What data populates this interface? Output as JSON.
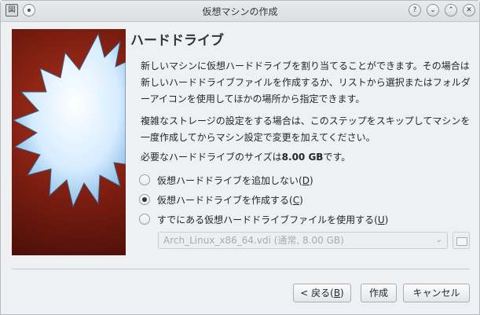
{
  "window": {
    "title": "仮想マシンの作成",
    "app_icon_glyph": "図",
    "controls": {
      "help": "?",
      "minimize": "⌄",
      "maximize": "⌃",
      "close": "✕"
    }
  },
  "page": {
    "heading": "ハードドライブ",
    "paragraph1": "新しいマシンに仮想ハードドライブを割り当てることができます。その場合は新しいハードドライブファイルを作成するか、リストから選択またはフォルダーアイコンを使用してほかの場所から指定できます。",
    "paragraph2": "複雑なストレージの設定をする場合は、このステップをスキップしてマシンを一度作成してからマシン設定で変更を加えてください。",
    "paragraph3_prefix": "必要なハードドライブのサイズは",
    "paragraph3_size": "8.00 GB",
    "paragraph3_suffix": "です。"
  },
  "options": [
    {
      "label": "仮想ハードドライブを追加しない(",
      "mnemonic": "D",
      "close": ")",
      "checked": false
    },
    {
      "label": "仮想ハードドライブを作成する(",
      "mnemonic": "C",
      "close": ")",
      "checked": true
    },
    {
      "label": "すでにある仮想ハードドライブファイルを使用する(",
      "mnemonic": "U",
      "close": ")",
      "checked": false
    }
  ],
  "disk_select": {
    "value": "Arch_Linux_x86_64.vdi (通常, 8.00 GB)"
  },
  "buttons": {
    "back_prefix": "< 戻る(",
    "back_mnemonic": "B",
    "back_suffix": ")",
    "create": "作成",
    "cancel": "キャンセル"
  },
  "colors": {
    "window_bg": "#eff0f1",
    "image_bg": "#7a1d10",
    "starburst": "#cfe9ff"
  }
}
